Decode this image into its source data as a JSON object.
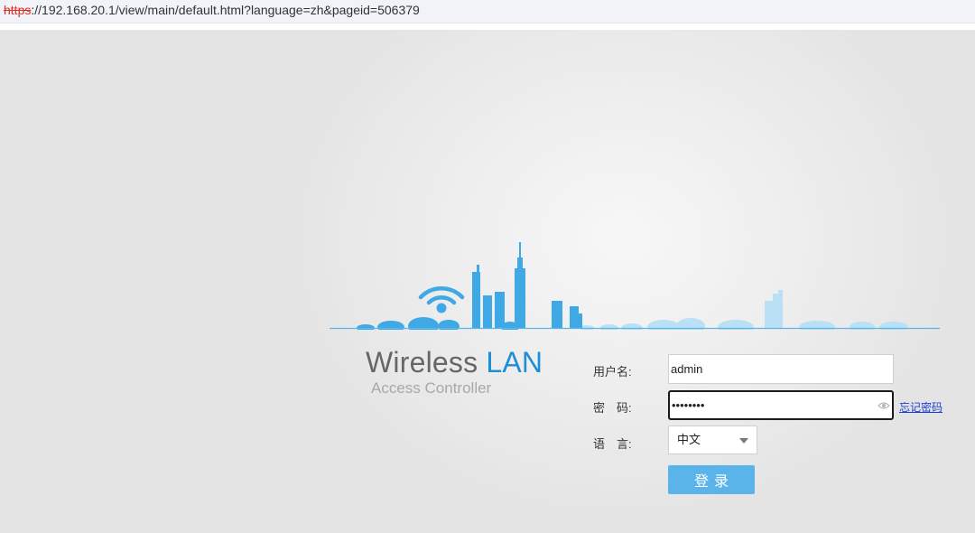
{
  "browser": {
    "url_scheme": "https",
    "url_rest": "://192.168.20.1/view/main/default.html?language=zh&pageid=506379"
  },
  "brand": {
    "title_main": "Wireless ",
    "title_accent": "LAN",
    "subtitle": "Access Controller",
    "accent_color": "#1c8fd8"
  },
  "login": {
    "username_label": "用户名:",
    "username_value": "admin",
    "password_label": "密　码:",
    "password_value": "password",
    "forgot_label": "忘记密码",
    "language_label": "语　言:",
    "language_value": "中文",
    "submit_label": "登录",
    "submit_color": "#5ab4ea"
  },
  "icons": {
    "logo": "wifi-city-skyline-icon",
    "reveal_password": "eye-icon",
    "dropdown": "chevron-down-icon"
  }
}
